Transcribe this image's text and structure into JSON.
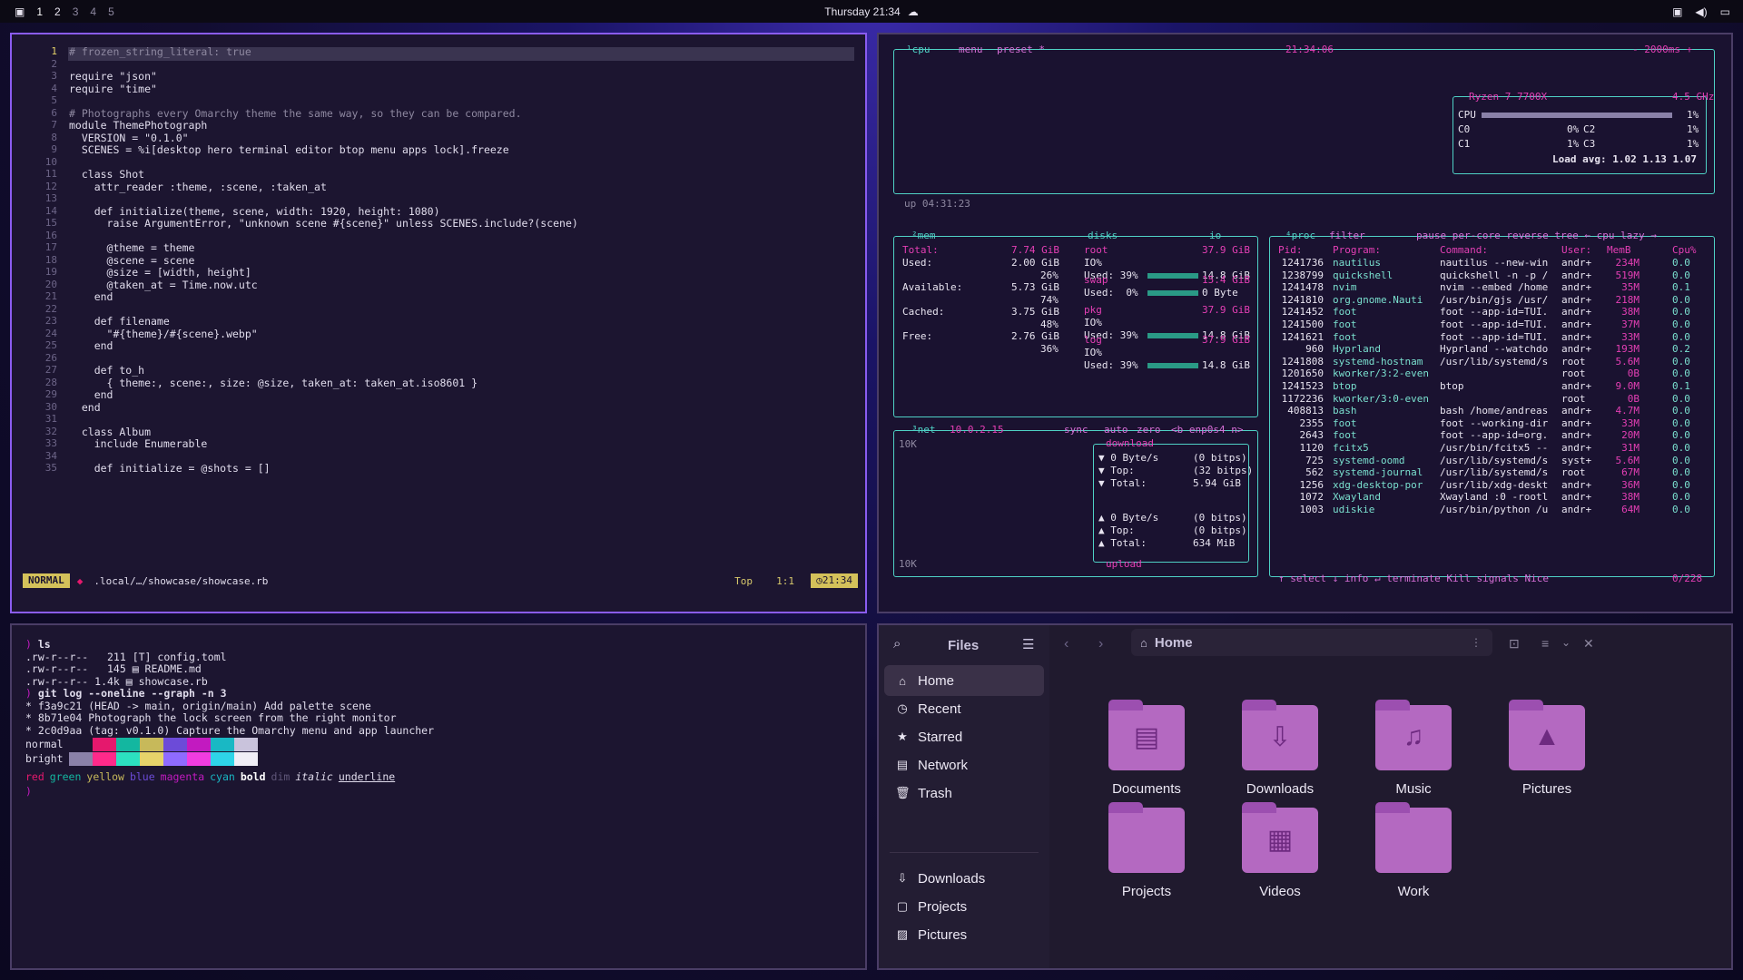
{
  "topbar": {
    "logo_icon": "grid-icon",
    "workspaces": [
      "1",
      "2",
      "3",
      "4",
      "5"
    ],
    "active_workspace": "1",
    "clock": "Thursday 21:34",
    "tray_icons": [
      "screen-icon",
      "volume-icon",
      "monitor-icon"
    ]
  },
  "editor": {
    "lines": [
      "# frozen_string_literal: true",
      "",
      "require \"json\"",
      "require \"time\"",
      "",
      "# Photographs every Omarchy theme the same way, so they can be compared.",
      "module ThemePhotograph",
      "  VERSION = \"0.1.0\"",
      "  SCENES = %i[desktop hero terminal editor btop menu apps lock].freeze",
      "",
      "  class Shot",
      "    attr_reader :theme, :scene, :taken_at",
      "",
      "    def initialize(theme, scene, width: 1920, height: 1080)",
      "      raise ArgumentError, \"unknown scene #{scene}\" unless SCENES.include?(scene)",
      "",
      "      @theme = theme",
      "      @scene = scene",
      "      @size = [width, height]",
      "      @taken_at = Time.now.utc",
      "    end",
      "",
      "    def filename",
      "      \"#{theme}/#{scene}.webp\"",
      "    end",
      "",
      "    def to_h",
      "      { theme:, scene:, size: @size, taken_at: taken_at.iso8601 }",
      "    end",
      "  end",
      "",
      "  class Album",
      "    include Enumerable",
      "",
      "    def initialize = @shots = []"
    ],
    "line_numbers": [
      "1",
      "2",
      "3",
      "4",
      "5",
      "6",
      "7",
      "8",
      "9",
      "10",
      "11",
      "12",
      "13",
      "14",
      "15",
      "16",
      "17",
      "18",
      "19",
      "20",
      "21",
      "22",
      "23",
      "24",
      "25",
      "26",
      "27",
      "28",
      "29",
      "30",
      "31",
      "32",
      "33",
      "34",
      "35"
    ],
    "mode": "NORMAL",
    "file": ".local/…/showcase/showcase.rb",
    "position": "Top",
    "cursor": "1:1",
    "time": "21:34"
  },
  "btop": {
    "cpu": {
      "title": "¹cpu",
      "menu": "menu",
      "preset": "preset *",
      "clock": "21:34:06",
      "refresh": "- 2000ms +",
      "model": "Ryzen 7 7700X",
      "freq": "4.5 GHz",
      "rows": [
        {
          "label": "CPU",
          "pct": "1%"
        },
        {
          "label": "C0",
          "pct": "0%"
        },
        {
          "label": "C2",
          "pct": "1%"
        },
        {
          "label": "C1",
          "pct": "1%"
        },
        {
          "label": "C3",
          "pct": "1%"
        }
      ],
      "load": "Load avg: 1.02 1.13 1.07",
      "uptime": "up 04:31:23"
    },
    "mem": {
      "title": "²mem",
      "total_label": "Total:",
      "total": "7.74 GiB",
      "rows": [
        {
          "label": "Used:",
          "value": "2.00 GiB",
          "pct": "26%"
        },
        {
          "label": "Available:",
          "value": "5.73 GiB",
          "pct": "74%"
        },
        {
          "label": "Cached:",
          "value": "3.75 GiB",
          "pct": "48%"
        },
        {
          "label": "Free:",
          "value": "2.76 GiB",
          "pct": "36%"
        }
      ]
    },
    "disks": {
      "title": "disks",
      "io": "io",
      "entries": [
        {
          "name": "root",
          "size": "37.9 GiB",
          "io": "IO%",
          "used": "Used: 39%",
          "amount": "14.8 GiB"
        },
        {
          "name": "swap",
          "size": "15.4 GiB",
          "io": "IO%",
          "used": "Used:  0%",
          "amount": "0 Byte"
        },
        {
          "name": "pkg",
          "size": "37.9 GiB",
          "io": "IO%",
          "used": "Used: 39%",
          "amount": "14.8 GiB"
        },
        {
          "name": "log",
          "size": "37.9 GiB",
          "io": "IO%",
          "used": "Used: 39%",
          "amount": "14.8 GiB"
        }
      ]
    },
    "net": {
      "title": "³net",
      "ip": "10.0.2.15",
      "sync": "sync",
      "auto": "auto",
      "zero": "zero",
      "iface": "<b enp0s4 n>",
      "scale_top": "10K",
      "scale_bottom": "10K",
      "download": "download",
      "upload": "upload",
      "down_rows": [
        {
          "k": "▼ 0 Byte/s",
          "v": "(0 bitps)"
        },
        {
          "k": "▼ Top:",
          "v": "(32 bitps)"
        },
        {
          "k": "▼ Total:",
          "v": "5.94 GiB"
        }
      ],
      "up_rows": [
        {
          "k": "▲ 0 Byte/s",
          "v": "(0 bitps)"
        },
        {
          "k": "▲ Top:",
          "v": "(0 bitps)"
        },
        {
          "k": "▲ Total:",
          "v": "634 MiB"
        }
      ]
    },
    "proc": {
      "title": "⁴proc",
      "filter": "filter",
      "header_opts": "pause per-core reverse tree ← cpu lazy →",
      "cols": [
        "Pid:",
        "Program:",
        "Command:",
        "User:",
        "MemB",
        "Cpu%"
      ],
      "rows": [
        [
          "1241736",
          "nautilus",
          "nautilus --new-win",
          "andr+",
          "234M",
          "0.0"
        ],
        [
          "1238799",
          "quickshell",
          "quickshell -n -p /",
          "andr+",
          "519M",
          "0.0"
        ],
        [
          "1241478",
          "nvim",
          "nvim --embed /home",
          "andr+",
          "35M",
          "0.1"
        ],
        [
          "1241810",
          "org.gnome.Nauti",
          "/usr/bin/gjs /usr/",
          "andr+",
          "218M",
          "0.0"
        ],
        [
          "1241452",
          "foot",
          "foot --app-id=TUI.",
          "andr+",
          "38M",
          "0.0"
        ],
        [
          "1241500",
          "foot",
          "foot --app-id=TUI.",
          "andr+",
          "37M",
          "0.0"
        ],
        [
          "1241621",
          "foot",
          "foot --app-id=TUI.",
          "andr+",
          "33M",
          "0.0"
        ],
        [
          "960",
          "Hyprland",
          "Hyprland --watchdo",
          "andr+",
          "193M",
          "0.2"
        ],
        [
          "1241808",
          "systemd-hostnam",
          "/usr/lib/systemd/s",
          "root",
          "5.6M",
          "0.0"
        ],
        [
          "1201650",
          "kworker/3:2-even",
          "",
          "root",
          "0B",
          "0.0"
        ],
        [
          "1241523",
          "btop",
          "btop",
          "andr+",
          "9.0M",
          "0.1"
        ],
        [
          "1172236",
          "kworker/3:0-even",
          "",
          "root",
          "0B",
          "0.0"
        ],
        [
          "408813",
          "bash",
          "bash /home/andreas",
          "andr+",
          "4.7M",
          "0.0"
        ],
        [
          "2355",
          "foot",
          "foot --working-dir",
          "andr+",
          "33M",
          "0.0"
        ],
        [
          "2643",
          "foot",
          "foot --app-id=org.",
          "andr+",
          "20M",
          "0.0"
        ],
        [
          "1120",
          "fcitx5",
          "/usr/bin/fcitx5 --",
          "andr+",
          "31M",
          "0.0"
        ],
        [
          "725",
          "systemd-oomd",
          "/usr/lib/systemd/s",
          "syst+",
          "5.6M",
          "0.0"
        ],
        [
          "562",
          "systemd-journal",
          "/usr/lib/systemd/s",
          "root",
          "67M",
          "0.0"
        ],
        [
          "1256",
          "xdg-desktop-por",
          "/usr/lib/xdg-deskt",
          "andr+",
          "36M",
          "0.0"
        ],
        [
          "1072",
          "Xwayland",
          "Xwayland :0 -rootl",
          "andr+",
          "38M",
          "0.0"
        ],
        [
          "1003",
          "udiskie",
          "/usr/bin/python /u",
          "andr+",
          "64M",
          "0.0"
        ]
      ],
      "footer": "↑ select ↓ info ↵ terminate Kill signals Nice",
      "count": "0/228"
    }
  },
  "term": {
    "lines": [
      {
        "prompt": ") ",
        "text": "ls"
      },
      {
        "text": ".rw-r--r--   211 [T] config.toml"
      },
      {
        "text": ".rw-r--r--   145 ▤ README.md"
      },
      {
        "text": ".rw-r--r-- 1.4k ▤ showcase.rb"
      },
      {
        "prompt": ") ",
        "text": "git log --oneline --graph -n 3"
      },
      {
        "text": "* f3a9c21 (HEAD -> main, origin/main) Add palette scene"
      },
      {
        "text": "* 8b71e04 Photograph the lock screen from the right monitor"
      },
      {
        "text": "* 2c0d9aa (tag: v0.1.0) Capture the Omarchy menu and app launcher"
      }
    ],
    "normal_label": "normal",
    "bright_label": "bright",
    "normal_colors": [
      "#1c1530",
      "#e5186d",
      "#13b7a0",
      "#c7b95a",
      "#6c4bd8",
      "#c21ac0",
      "#19b8c4",
      "#c9c3dc"
    ],
    "bright_colors": [
      "#8a81a8",
      "#ff2a8a",
      "#2ce0c0",
      "#e6d36a",
      "#8f6bff",
      "#f13ce0",
      "#2ed5e8",
      "#f0eef6"
    ],
    "styles": [
      "red",
      "green",
      "yellow",
      "blue",
      "magenta",
      "cyan",
      "bold",
      "dim",
      "italic",
      "underline"
    ],
    "last_prompt": ")"
  },
  "files": {
    "title": "Files",
    "location": "Home",
    "sidebar": [
      {
        "label": "Home",
        "icon": "home-icon"
      },
      {
        "label": "Recent",
        "icon": "clock-icon"
      },
      {
        "label": "Starred",
        "icon": "star-icon"
      },
      {
        "label": "Network",
        "icon": "network-icon"
      },
      {
        "label": "Trash",
        "icon": "trash-icon"
      }
    ],
    "bookmarks": [
      {
        "label": "Downloads",
        "icon": "download-icon"
      },
      {
        "label": "Projects",
        "icon": "folder-icon"
      },
      {
        "label": "Pictures",
        "icon": "image-icon"
      }
    ],
    "folders": [
      {
        "label": "Documents",
        "icon": "document-icon"
      },
      {
        "label": "Downloads",
        "icon": "download-icon"
      },
      {
        "label": "Music",
        "icon": "music-icon"
      },
      {
        "label": "Pictures",
        "icon": "image-icon"
      },
      {
        "label": "Projects",
        "icon": "folder-icon"
      },
      {
        "label": "Videos",
        "icon": "film-icon"
      },
      {
        "label": "Work",
        "icon": "folder-icon"
      }
    ]
  }
}
